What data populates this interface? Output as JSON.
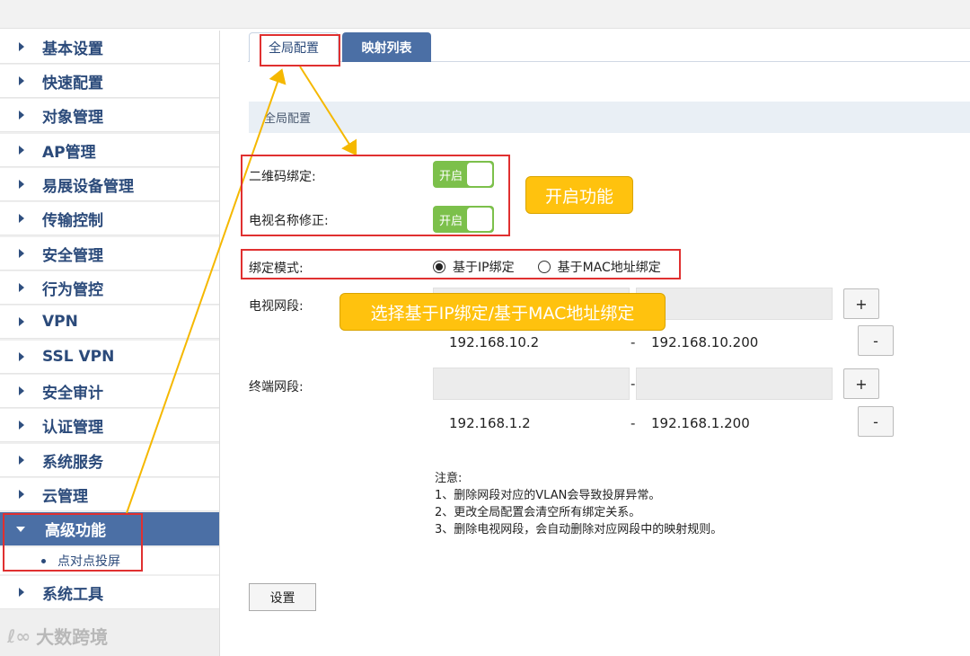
{
  "sidebar": {
    "items": [
      {
        "label": "基本设置"
      },
      {
        "label": "快速配置"
      },
      {
        "label": "对象管理"
      },
      {
        "label": "AP管理"
      },
      {
        "label": "易展设备管理"
      },
      {
        "label": "传输控制"
      },
      {
        "label": "安全管理"
      },
      {
        "label": "行为管控"
      },
      {
        "label": "VPN"
      },
      {
        "label": "SSL VPN"
      },
      {
        "label": "安全审计"
      },
      {
        "label": "认证管理"
      },
      {
        "label": "系统服务"
      },
      {
        "label": "云管理"
      },
      {
        "label": "高级功能"
      },
      {
        "label": "系统工具"
      }
    ],
    "active_index": 14,
    "sub_item": {
      "label": "点对点投屏"
    }
  },
  "tabs": [
    {
      "label": "全局配置",
      "selected": true
    },
    {
      "label": "映射列表",
      "selected": false
    }
  ],
  "section": {
    "title": "全局配置"
  },
  "form": {
    "qr_binding": {
      "label": "二维码绑定:",
      "toggle": "开启"
    },
    "tv_name_fix": {
      "label": "电视名称修正:",
      "toggle": "开启"
    },
    "binding_mode": {
      "label": "绑定模式:",
      "options": [
        {
          "label": "基于IP绑定",
          "selected": true
        },
        {
          "label": "基于MAC地址绑定",
          "selected": false
        }
      ]
    },
    "tv_segment": {
      "label": "电视网段:",
      "ranges": [
        {
          "start": "192.168.10.2",
          "sep": "-",
          "end": "192.168.10.200"
        }
      ],
      "add": "+",
      "remove": "-"
    },
    "terminal_segment": {
      "label": "终端网段:",
      "input_sep": "-",
      "ranges": [
        {
          "start": "192.168.1.2",
          "sep": "-",
          "end": "192.168.1.200"
        }
      ],
      "add": "+",
      "remove": "-"
    }
  },
  "notes": {
    "title": "注意:",
    "lines": [
      "1、删除网段对应的VLAN会导致投屏异常。",
      "2、更改全局配置会清空所有绑定关系。",
      "3、删除电视网段，会自动删除对应网段中的映射规则。"
    ]
  },
  "submit_label": "设置",
  "annotations": {
    "enable_callout": "开启功能",
    "mode_callout": "选择基于IP绑定/基于MAC地址绑定",
    "box_color": "#e03030",
    "arrow_color": "#f5b800"
  },
  "watermark": "大数跨境",
  "colors": {
    "accent": "#4b6fa5",
    "toggle_on": "#7cc04b",
    "callout": "#ffc20e"
  }
}
